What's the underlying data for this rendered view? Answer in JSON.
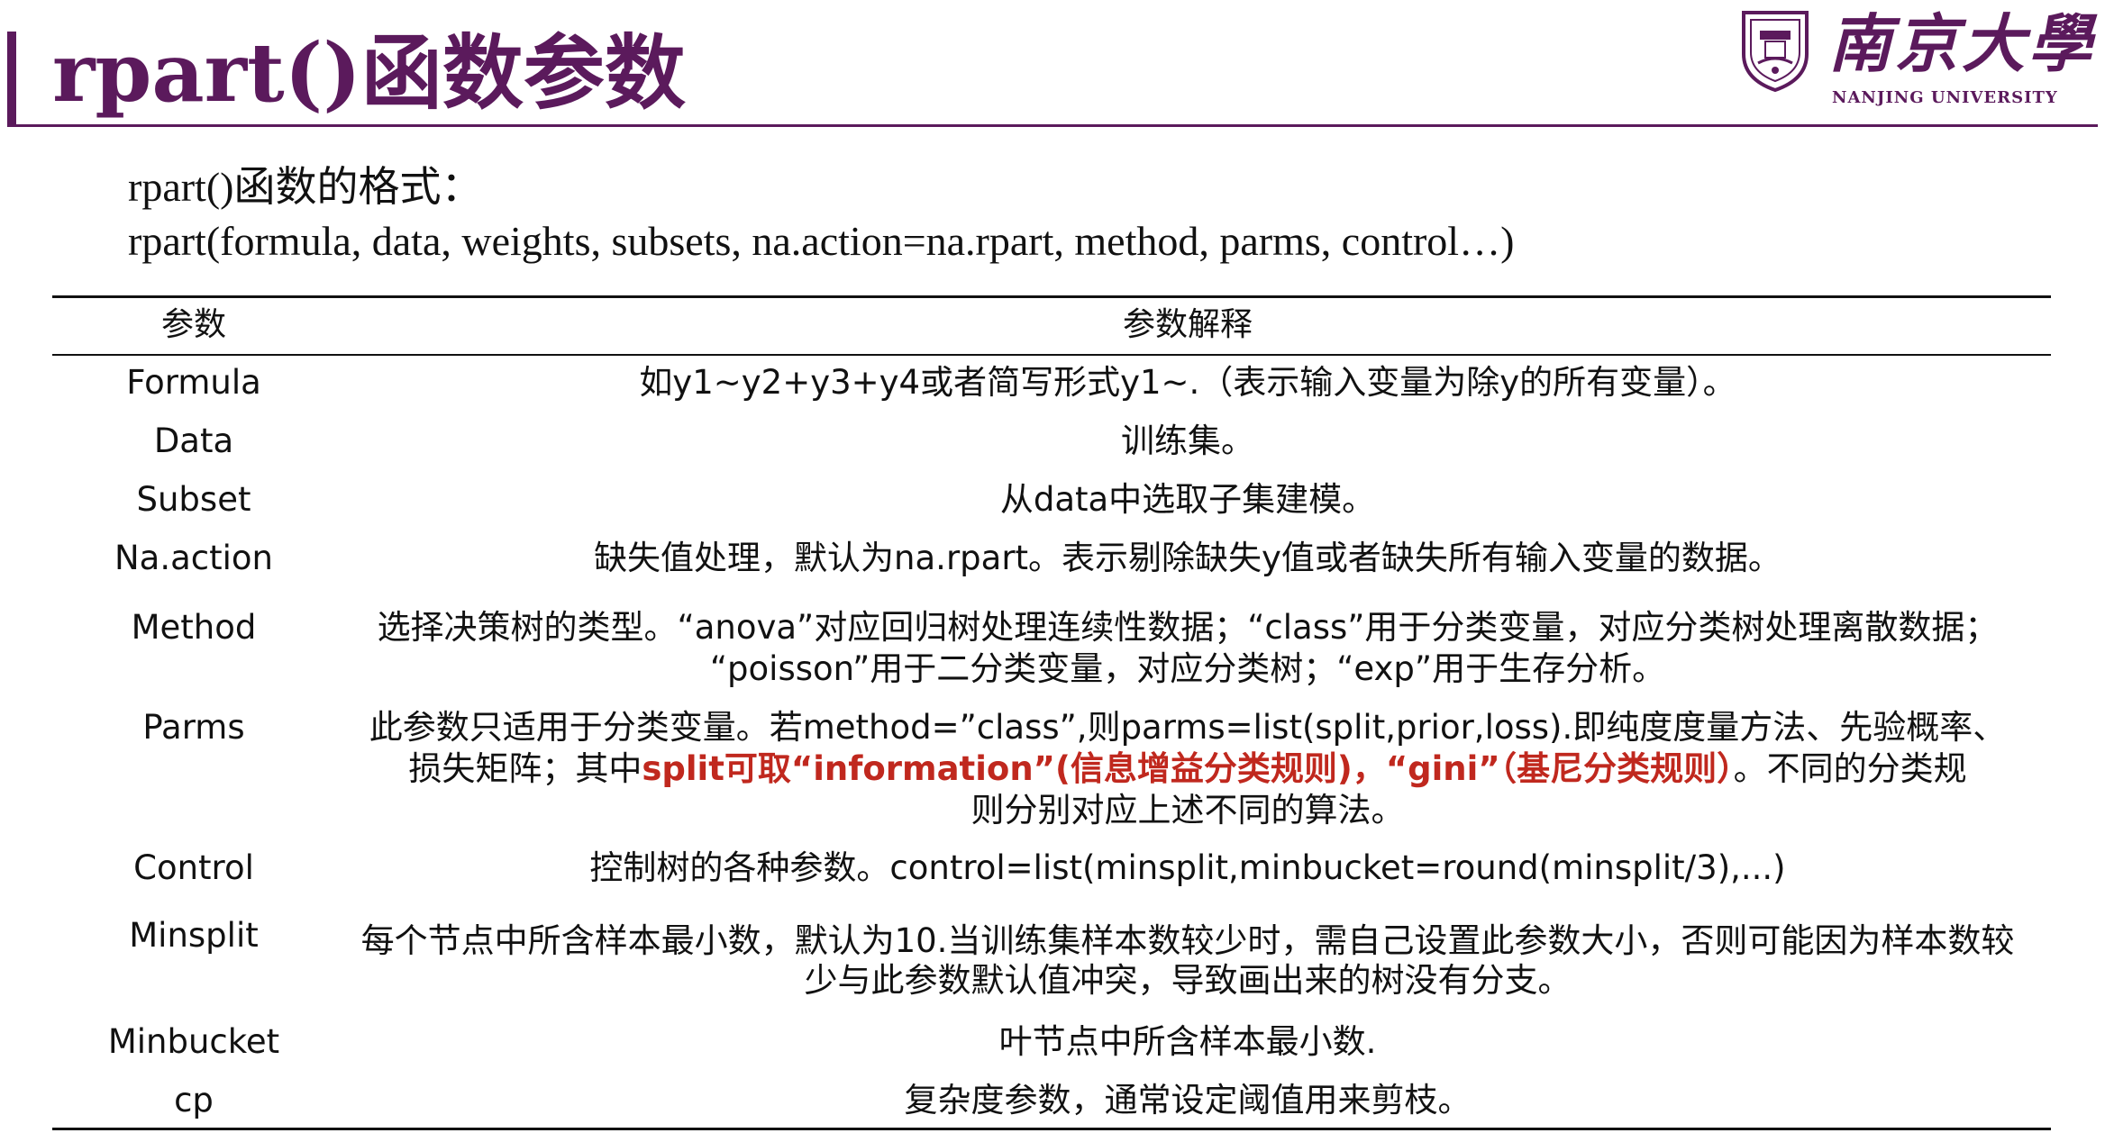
{
  "header": {
    "title": "rpart()函数参数",
    "logo_cn": "南京大學",
    "logo_en": "NANJING UNIVERSITY",
    "brand_color": "#5b1a5c"
  },
  "format": {
    "line1": "rpart()函数的格式：",
    "line2": "rpart(formula, data, weights, subsets, na.action=na.rpart, method, parms, control…)"
  },
  "table": {
    "headers": [
      "参数",
      "参数解释"
    ],
    "rows": [
      {
        "param": "Formula",
        "desc": [
          "如y1~y2+y3+y4或者简写形式y1~.（表示输入变量为除y的所有变量）。"
        ]
      },
      {
        "param": "Data",
        "desc": [
          "训练集。"
        ]
      },
      {
        "param": "Subset",
        "desc": [
          "从data中选取子集建模。"
        ]
      },
      {
        "param": "Na.action",
        "desc": [
          "缺失值处理，默认为na.rpart。表示剔除缺失y值或者缺失所有输入变量的数据。"
        ]
      },
      {
        "param": "Method",
        "desc": [
          "选择决策树的类型。“anova”对应回归树处理连续性数据；“class”用于分类变量，对应分类树处理离散数据；",
          "“poisson”用于二分类变量，对应分类树；“exp”用于生存分析。"
        ]
      },
      {
        "param": "Parms",
        "desc": [
          "此参数只适用于分类变量。若method=”class”,则parms=list(split,prior,loss).即纯度度量方法、先验概率、",
          "损失矩阵；其中",
          "split可取“information”(信息增益分类规则)，“gini”（基尼分类规则）",
          "。不同的分类规",
          "则分别对应上述不同的算法。"
        ]
      },
      {
        "param": "Control",
        "desc": [
          "控制树的各种参数。control=list(minsplit,minbucket=round(minsplit/3),...)"
        ]
      },
      {
        "param": "Minsplit",
        "desc": [
          "每个节点中所含样本最小数，默认为10.当训练集样本数较少时，需自己设置此参数大小，否则可能因为样本数较",
          "少与此参数默认值冲突，导致画出来的树没有分支。"
        ]
      },
      {
        "param": "Minbucket",
        "desc": [
          "叶节点中所含样本最小数."
        ]
      },
      {
        "param": "cp",
        "desc": [
          "复杂度参数，通常设定阈值用来剪枝。"
        ]
      }
    ],
    "highlight_color": "#c0281e"
  }
}
